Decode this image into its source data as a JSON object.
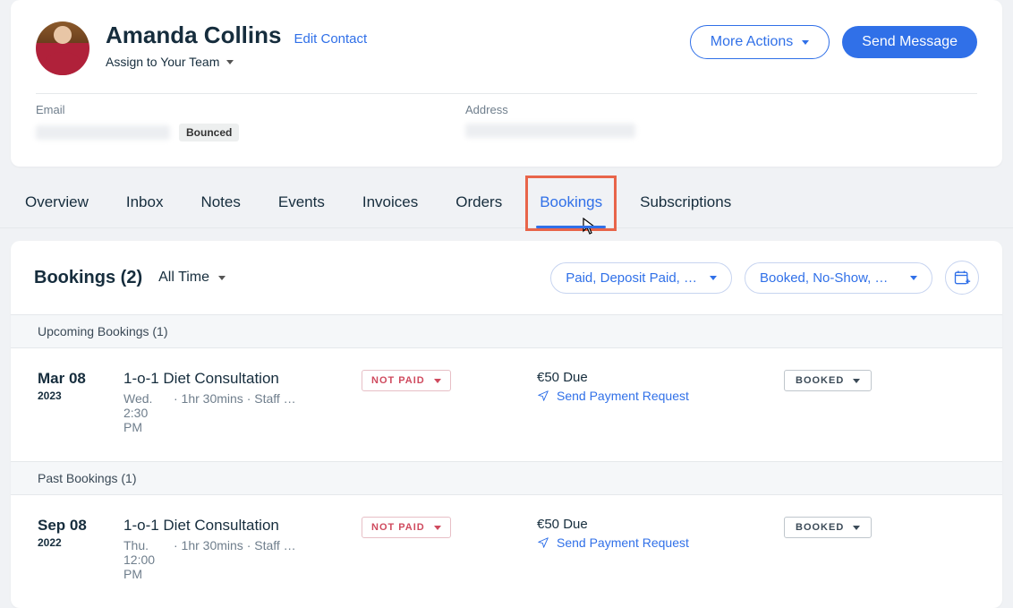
{
  "contact": {
    "name": "Amanda Collins",
    "edit_label": "Edit Contact",
    "assign_label": "Assign to Your Team"
  },
  "header_actions": {
    "more": "More Actions",
    "send": "Send Message"
  },
  "meta": {
    "email_label": "Email",
    "email_badge": "Bounced",
    "address_label": "Address"
  },
  "tabs": {
    "overview": "Overview",
    "inbox": "Inbox",
    "notes": "Notes",
    "events": "Events",
    "invoices": "Invoices",
    "orders": "Orders",
    "bookings": "Bookings",
    "subscriptions": "Subscriptions"
  },
  "bookings": {
    "title": "Bookings (2)",
    "time_filter": "All Time",
    "payment_filter": "Paid, Deposit Paid, …",
    "status_filter": "Booked, No-Show, C…",
    "upcoming_header": "Upcoming Bookings (1)",
    "past_header": "Past Bookings (1)",
    "items": [
      {
        "date": "Mar 08",
        "year": "2023",
        "day_time": "Wed. 2:30 PM",
        "title": "1-o-1 Diet Consultation",
        "meta": "· 1hr 30mins · Staff …",
        "pay_status": "NOT PAID",
        "due": "€50 Due",
        "pay_link": "Send Payment Request",
        "book_status": "BOOKED"
      },
      {
        "date": "Sep 08",
        "year": "2022",
        "day_time": "Thu. 12:00 PM",
        "title": "1-o-1 Diet Consultation",
        "meta": "· 1hr 30mins · Staff …",
        "pay_status": "NOT PAID",
        "due": "€50 Due",
        "pay_link": "Send Payment Request",
        "book_status": "BOOKED"
      }
    ]
  }
}
